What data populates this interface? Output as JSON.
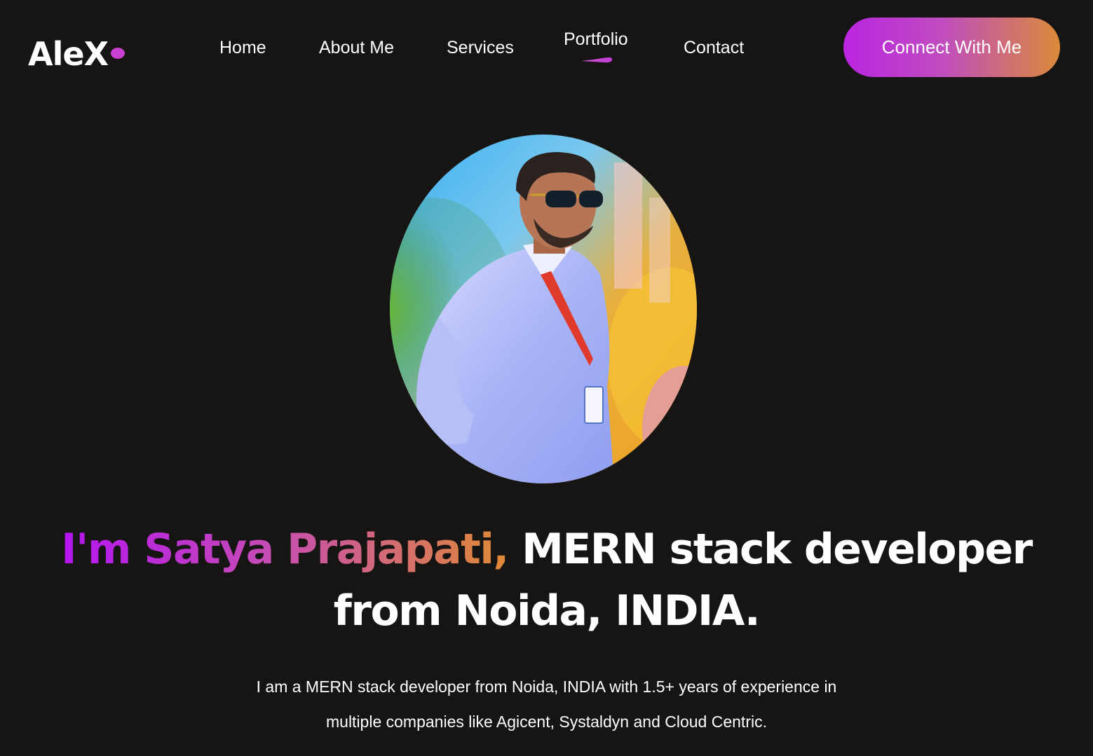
{
  "logo": {
    "text": "AleX"
  },
  "nav": {
    "items": [
      {
        "label": "Home"
      },
      {
        "label": "About Me"
      },
      {
        "label": "Services"
      },
      {
        "label": "Portfolio",
        "active": true
      },
      {
        "label": "Contact"
      }
    ]
  },
  "cta": {
    "label": "Connect With Me"
  },
  "hero": {
    "headline_highlight": "I'm Satya Prajapati,",
    "headline_rest_line1": "MERN stack developer",
    "headline_line2": "from Noida, INDIA.",
    "description_line1": "I am a MERN stack developer from Noida, INDIA with 1.5+ years of experience in",
    "description_line2": "multiple companies like Agicent, Systaldyn and Cloud Centric."
  },
  "colors": {
    "background": "#161513",
    "accent_start": "#b415f0",
    "accent_end": "#e08a36",
    "text": "#ffffff"
  },
  "icons": {
    "active_nav_indicator": "brush-stroke-underline",
    "profile": "profile-photo"
  }
}
